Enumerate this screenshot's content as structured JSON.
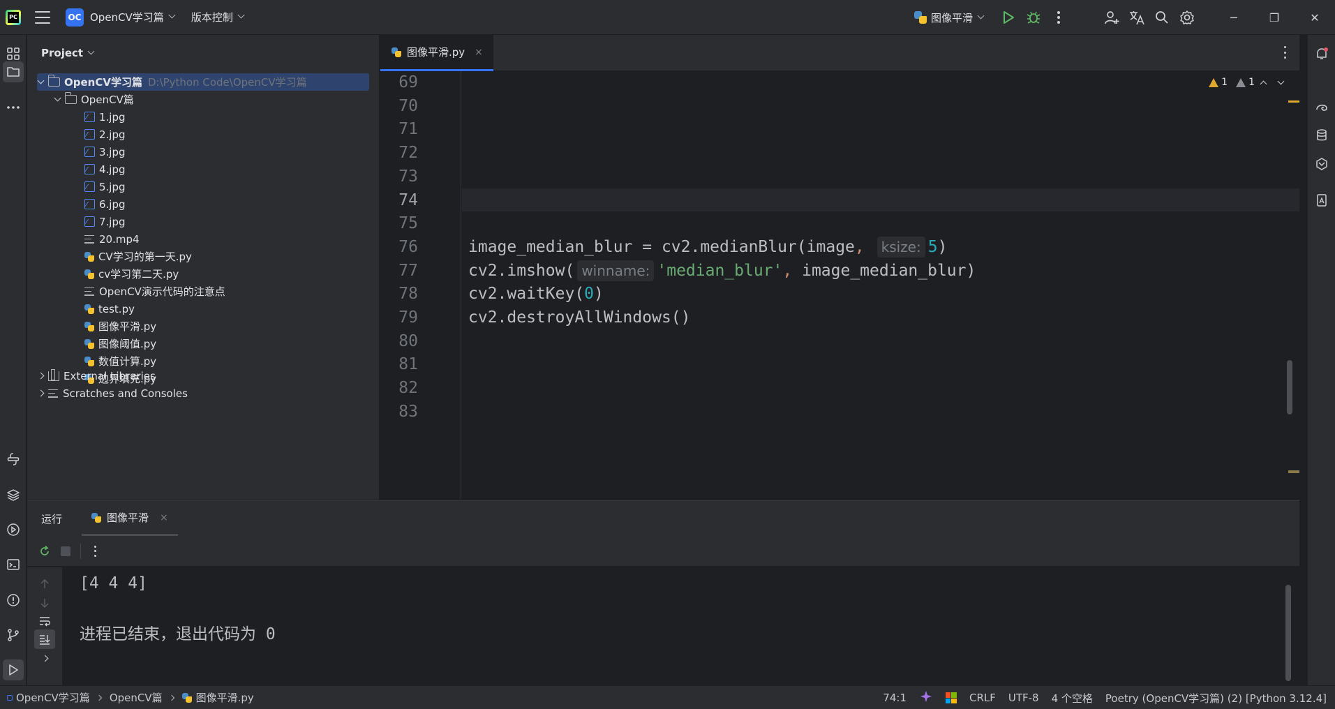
{
  "titlebar": {
    "project_badge": "OC",
    "project_name": "OpenCV学习篇",
    "vcs_menu": "版本控制",
    "run_config": "图像平滑",
    "minimize": "─",
    "restore": "❐",
    "close": "✕"
  },
  "project_panel": {
    "title": "Project",
    "root": {
      "name": "OpenCV学习篇",
      "path": "D:\\Python Code\\OpenCV学习篇"
    },
    "folder": "OpenCV篇",
    "files": [
      {
        "name": "1.jpg",
        "icon": "image-file-icon"
      },
      {
        "name": "2.jpg",
        "icon": "image-file-icon"
      },
      {
        "name": "3.jpg",
        "icon": "image-file-icon"
      },
      {
        "name": "4.jpg",
        "icon": "image-file-icon"
      },
      {
        "name": "5.jpg",
        "icon": "image-file-icon"
      },
      {
        "name": "6.jpg",
        "icon": "image-file-icon"
      },
      {
        "name": "7.jpg",
        "icon": "image-file-icon"
      },
      {
        "name": "20.mp4",
        "icon": "text-file-icon"
      },
      {
        "name": "CV学习的第一天.py",
        "icon": "python-file-icon"
      },
      {
        "name": "cv学习第二天.py",
        "icon": "python-file-icon"
      },
      {
        "name": "OpenCV演示代码的注意点",
        "icon": "text-file-icon"
      },
      {
        "name": "test.py",
        "icon": "python-file-icon"
      },
      {
        "name": "图像平滑.py",
        "icon": "python-file-icon"
      },
      {
        "name": "图像阈值.py",
        "icon": "python-file-icon"
      },
      {
        "name": "数值计算.py",
        "icon": "python-file-icon"
      },
      {
        "name": "边界填充.py",
        "icon": "python-file-icon"
      }
    ],
    "external_libraries": "External Libraries",
    "scratches": "Scratches and Consoles"
  },
  "editor": {
    "tab_name": "图像平滑.py",
    "tab_close": "×",
    "warnings_count": "1",
    "weak_warnings_count": "1",
    "current_line": "74",
    "line_numbers": [
      "69",
      "70",
      "71",
      "72",
      "73",
      "74",
      "75",
      "76",
      "77",
      "78",
      "79",
      "80",
      "81",
      "82",
      "83"
    ],
    "code": {
      "l76_a": "image_median_blur = cv2.medianBlur(image",
      "l76_comma": ",",
      "l76_hint": "ksize:",
      "l76_num": "5",
      "l76_end": ")",
      "l77_a": "cv2.imshow(",
      "l77_hint": "winname:",
      "l77_str": "'median_blur'",
      "l77_comma": ",",
      "l77_b": " image_median_blur)",
      "l78_a": "cv2.waitKey(",
      "l78_num": "0",
      "l78_end": ")",
      "l79": "cv2.destroyAllWindows()"
    }
  },
  "run_panel": {
    "title": "运行",
    "tab_name": "图像平滑",
    "tab_close": "×",
    "output": [
      "[4 4 4]",
      "进程已结束，退出代码为 0"
    ]
  },
  "statusbar": {
    "breadcrumbs": [
      "OpenCV学习篇",
      "OpenCV篇",
      "图像平滑.py"
    ],
    "position": "74:1",
    "line_sep": "CRLF",
    "encoding": "UTF-8",
    "indent": "4 个空格",
    "interpreter": "Poetry (OpenCV学习篇) (2) [Python 3.12.4]"
  },
  "colors": {
    "accent": "#3574f0",
    "run_green": "#5fb865",
    "warning": "#e0a82e",
    "string": "#6aab73",
    "number": "#2aacb8"
  }
}
